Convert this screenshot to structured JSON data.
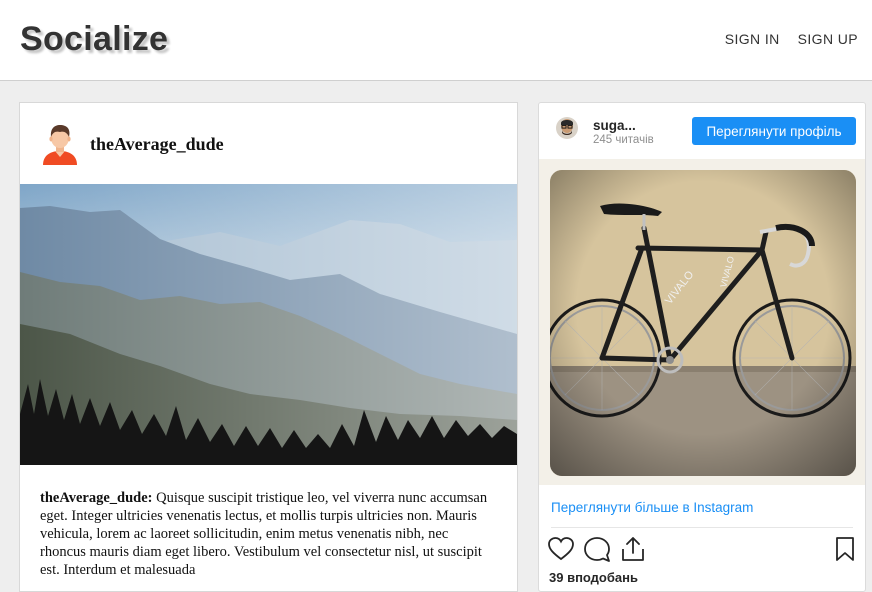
{
  "header": {
    "brand": "Socialize",
    "nav": {
      "sign_in": "SIGN IN",
      "sign_up": "SIGN UP"
    }
  },
  "post": {
    "username": "theAverage_dude",
    "avatar_icon": "user-avatar-icon",
    "image_subject": "misty mountain ridges with pine forest silhouette",
    "caption_author": "theAverage_dude:",
    "caption_text": " Quisque suscipit tristique leo, vel viverra nunc accumsan eget. Integer ultricies venenatis lectus, et mollis turpis ultricies non. Mauris vehicula, lorem ac laoreet sollicitudin, enim metus venenatis nibh, nec rhoncus mauris diam eget libero. Vestibulum vel consectetur nisl, ut suscipit est. Interdum et malesuada"
  },
  "instagram": {
    "username": "suga...",
    "followers": "245 читачів",
    "view_profile": "Переглянути профіль",
    "view_more": "Переглянути більше в Instagram",
    "likes": "39 вподобань",
    "icons": [
      "heart-icon",
      "comment-icon",
      "share-icon",
      "bookmark-icon"
    ],
    "photo_subject": "black track bicycle against a beige wall",
    "accent_color": "#1a8ff5"
  }
}
